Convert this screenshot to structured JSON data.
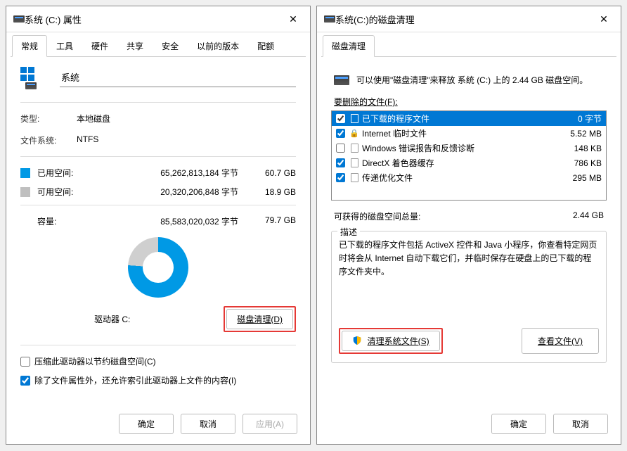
{
  "properties_window": {
    "title": "系统 (C:) 属性",
    "tabs": [
      "常规",
      "工具",
      "硬件",
      "共享",
      "安全",
      "以前的版本",
      "配额"
    ],
    "active_tab": 0,
    "volume_name": "系统",
    "type_label": "类型:",
    "type_value": "本地磁盘",
    "fs_label": "文件系统:",
    "fs_value": "NTFS",
    "used_label": "已用空间:",
    "used_bytes": "65,262,813,184 字节",
    "used_gb": "60.7 GB",
    "free_label": "可用空间:",
    "free_bytes": "20,320,206,848 字节",
    "free_gb": "18.9 GB",
    "capacity_label": "容量:",
    "capacity_bytes": "85,583,020,032 字节",
    "capacity_gb": "79.7 GB",
    "drive_label": "驱动器 C:",
    "disk_cleanup_btn": "磁盘清理(D)",
    "compress_label": "压缩此驱动器以节约磁盘空间(C)",
    "index_label": "除了文件属性外，还允许索引此驱动器上文件的内容(I)",
    "ok": "确定",
    "cancel": "取消",
    "apply": "应用(A)"
  },
  "cleanup_window": {
    "title": "系统(C:)的磁盘清理",
    "tab": "磁盘清理",
    "intro": "可以使用\"磁盘清理\"来释放 系统 (C:) 上的 2.44 GB 磁盘空间。",
    "delete_label": "要删除的文件(F):",
    "files": [
      {
        "name": "已下载的程序文件",
        "size": "0 字节",
        "checked": true,
        "selected": true,
        "icon": "doc"
      },
      {
        "name": "Internet 临时文件",
        "size": "5.52 MB",
        "checked": true,
        "selected": false,
        "icon": "lock"
      },
      {
        "name": "Windows 错误报告和反馈诊断",
        "size": "148 KB",
        "checked": false,
        "selected": false,
        "icon": "doc"
      },
      {
        "name": "DirectX 着色器缓存",
        "size": "786 KB",
        "checked": true,
        "selected": false,
        "icon": "doc"
      },
      {
        "name": "传递优化文件",
        "size": "295 MB",
        "checked": true,
        "selected": false,
        "icon": "doc"
      }
    ],
    "gain_label": "可获得的磁盘空间总量:",
    "gain_value": "2.44 GB",
    "desc_legend": "描述",
    "desc_text": "已下载的程序文件包括 ActiveX 控件和 Java 小程序，你查看特定网页时将会从 Internet 自动下载它们，并临时保存在硬盘上的已下载的程序文件夹中。",
    "clean_system_btn": "清理系统文件(S)",
    "view_files_btn": "查看文件(V)",
    "ok": "确定",
    "cancel": "取消"
  }
}
